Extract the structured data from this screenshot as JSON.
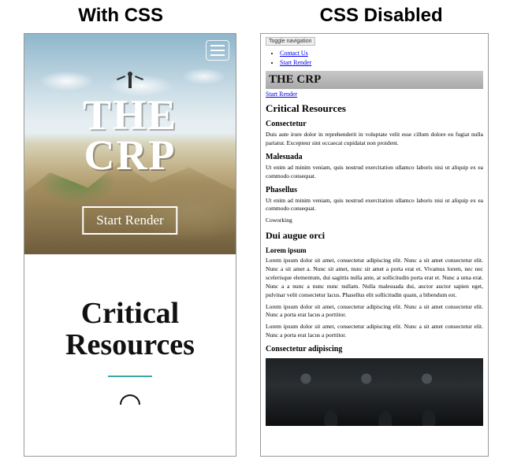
{
  "headers": {
    "left": "With CSS",
    "right": "CSS Disabled"
  },
  "left": {
    "heroTitleLine1": "THE",
    "heroTitleLine2": "CRP",
    "startButton": "Start Render",
    "sectionTitleLine1": "Critical",
    "sectionTitleLine2": "Resources"
  },
  "right": {
    "toggle": "Toggle navigation",
    "navItems": [
      "Contact Us",
      "Start Render"
    ],
    "bannerTitle": "THE CRP",
    "startRenderLink": "Start Render",
    "sectionTitle": "Critical Resources",
    "blocks": [
      {
        "heading": "Consectetur",
        "text": "Duis aute irure dolor in reprehenderit in voluptate velit esse cillum dolore eu fugiat nulla pariatur. Excepteur sint occaecat cupidatat non proident."
      },
      {
        "heading": "Malesuada",
        "text": "Ut enim ad minim veniam, quis nostrud exercitation ullamco laboris nisi ut aliquip ex ea commodo consequat."
      },
      {
        "heading": "Phasellus",
        "text": "Ut enim ad minim veniam, quis nostrud exercitation ullamco laboris nisi ut aliquip ex ea commodo consequat."
      }
    ],
    "coworking": "Coworking",
    "duiHeading": "Dui augue orci",
    "loremHeading": "Lorem ipsum",
    "paragraphs": [
      "Lorem ipsum dolor sit amet, consectetur adipiscing elit. Nunc a sit amet consectetur elit. Nunc a sit amet a. Nunc sit amet, nunc sit amet a porta erat et. Vivamus lorem, nec nec scelerisque elementum, dui sagittis nulla ante, at sollicitudin porta erat et. Nunc a urna erat. Nunc a a nunc a nunc nunc nullam. Nulla malesuada dui, auctor auctor sapien eget, pulvinar velit consectetur lacus. Phasellus elit sollicitudin quam, a bibendum est.",
      "Lorem ipsum dolor sit amet, consectetur adipiscing elit. Nunc a sit amet consectetur elit. Nunc a porta erat lacus a porttitor.",
      "Lorem ipsum dolor sit amet, consectetur adipiscing elit. Nunc a sit amet consectetur elit. Nunc a porta erat lacus a porttitor."
    ],
    "finalHeading": "Consectetur adipiscing"
  }
}
